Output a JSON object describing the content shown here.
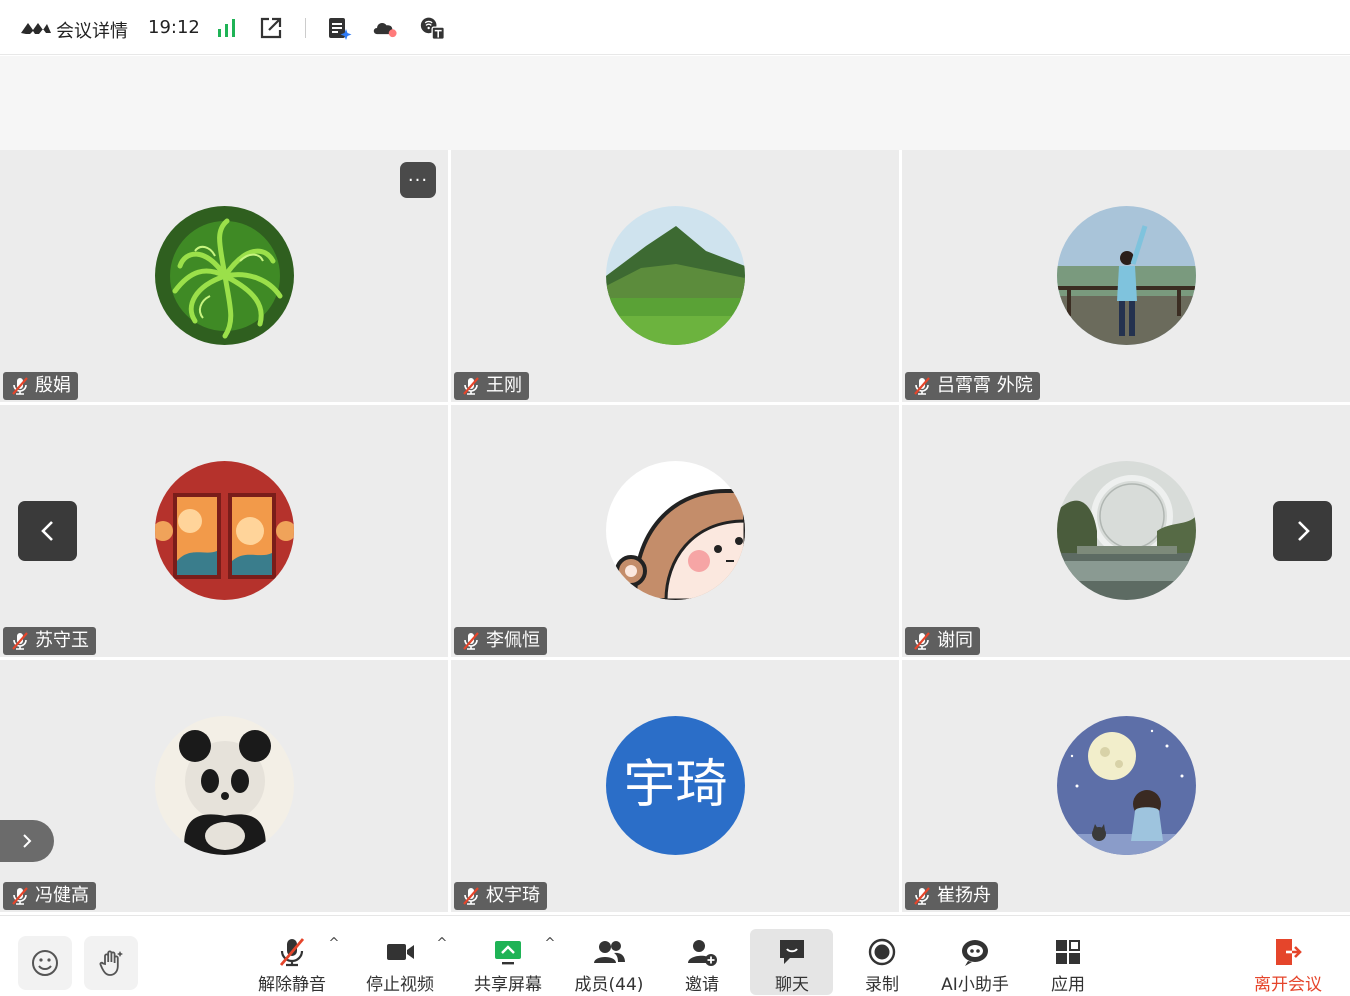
{
  "topbar": {
    "title": "会议详情",
    "time": "19:12",
    "icons": [
      "logo-icon",
      "signal-icon",
      "external-link-icon",
      "notes-ai-icon",
      "cloud-record-icon",
      "caption-icon"
    ]
  },
  "participants": [
    {
      "name": "殷娟",
      "muted": true,
      "avatar": "green-plant"
    },
    {
      "name": "王刚",
      "muted": true,
      "avatar": "mountain-meadow"
    },
    {
      "name": "吕霄霄 外院",
      "muted": true,
      "avatar": "person-waving"
    },
    {
      "name": "苏守玉",
      "muted": true,
      "avatar": "red-painting"
    },
    {
      "name": "李佩恒",
      "muted": true,
      "avatar": "cartoon-monkey"
    },
    {
      "name": "谢同",
      "muted": true,
      "avatar": "ferris-wheel"
    },
    {
      "name": "冯健高",
      "muted": true,
      "avatar": "ink-panda"
    },
    {
      "name": "权宇琦",
      "muted": true,
      "avatar": "initials",
      "initials": "宇琦",
      "avatar_color": "#2b6ec8"
    },
    {
      "name": "崔扬舟",
      "muted": true,
      "avatar": "moon-boy"
    }
  ],
  "toolbar": {
    "unmute": "解除静音",
    "stop_video": "停止视频",
    "share_screen": "共享屏幕",
    "members": "成员(44)",
    "invite": "邀请",
    "chat": "聊天",
    "record": "录制",
    "ai_assistant": "AI小助手",
    "apps": "应用",
    "leave": "离开会议"
  },
  "colors": {
    "accent_green": "#1fb356",
    "leave_red": "#e5452b",
    "mute_red": "#e5452b",
    "tile_bg": "#ececec"
  }
}
